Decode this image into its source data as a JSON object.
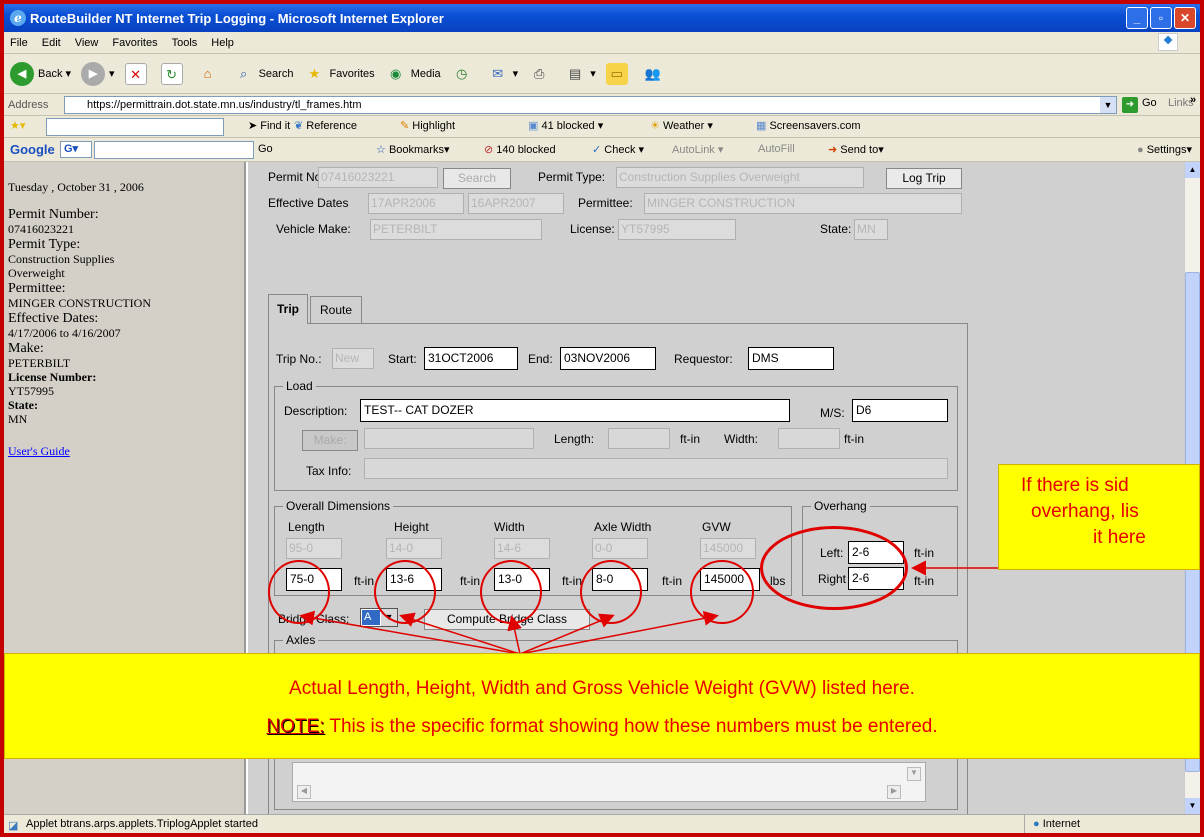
{
  "window": {
    "title": "RouteBuilder NT Internet Trip Logging - Microsoft Internet Explorer"
  },
  "menu": [
    "File",
    "Edit",
    "View",
    "Favorites",
    "Tools",
    "Help"
  ],
  "toolbar": {
    "back": "Back",
    "search": "Search",
    "favorites": "Favorites",
    "media": "Media"
  },
  "address": {
    "label": "Address",
    "url": "https://permittrain.dot.state.mn.us/industry/tl_frames.htm",
    "go": "Go",
    "links": "Links"
  },
  "linksbar": {
    "findit": "Find it",
    "reference": "Reference",
    "highlight": "Highlight",
    "blocked": "41 blocked",
    "weather": "Weather",
    "screensavers": "Screensavers.com"
  },
  "google": {
    "label": "Google",
    "go": "Go",
    "bookmarks": "Bookmarks",
    "blocked": "140 blocked",
    "check": "Check",
    "autolink": "AutoLink",
    "autofill": "AutoFill",
    "sendto": "Send to",
    "settings": "Settings"
  },
  "left": {
    "date": "Tuesday , October 31 , 2006",
    "permit_number_label": "Permit Number:",
    "permit_number": "07416023221",
    "permit_type_label": "Permit Type:",
    "permit_type": "Construction Supplies Overweight",
    "permittee_label": "Permittee:",
    "permittee": "MINGER CONSTRUCTION",
    "effective_label": "Effective Dates:",
    "effective": "4/17/2006 to 4/16/2007",
    "make_label": "Make:",
    "make": "PETERBILT",
    "license_label": "License Number:",
    "license": "YT57995",
    "state_label": "State:",
    "state": "MN",
    "guide": "User's Guide"
  },
  "form": {
    "permit_no_label": "Permit No.:",
    "permit_no": "07416023221",
    "search_btn": "Search",
    "permit_type_label": "Permit Type:",
    "permit_type": "Construction Supplies Overweight",
    "log_trip": "Log Trip",
    "eff_label": "Effective Dates",
    "eff_start": "17APR2006",
    "eff_end": "16APR2007",
    "permittee_label": "Permittee:",
    "permittee": "MINGER CONSTRUCTION",
    "vmake_label": "Vehicle Make:",
    "vmake": "PETERBILT",
    "license_label": "License:",
    "license": "YT57995",
    "state_label": "State:",
    "state": "MN",
    "tab_trip": "Trip",
    "tab_route": "Route",
    "tripno_label": "Trip No.:",
    "tripno": "New",
    "start_label": "Start:",
    "start": "31OCT2006",
    "end_label": "End:",
    "end": "03NOV2006",
    "requestor_label": "Requestor:",
    "requestor": "DMS",
    "load_label": "Load",
    "desc_label": "Description:",
    "desc": "TEST-- CAT DOZER",
    "ms_label": "M/S:",
    "ms": "D6",
    "make_btn": "Make:",
    "length_label": "Length:",
    "ftin": "ft-in",
    "width_label": "Width:",
    "tax_label": "Tax Info:",
    "overall_label": "Overall Dimensions",
    "col_length": "Length",
    "col_height": "Height",
    "col_width": "Width",
    "col_axle": "Axle Width",
    "col_gvw": "GVW",
    "max_length": "95-0",
    "max_height": "14-0",
    "max_width": "14-6",
    "max_axle": "0-0",
    "max_gvw": "145000",
    "length": "75-0",
    "height": "13-6",
    "width": "13-0",
    "axle": "8-0",
    "gvw": "145000",
    "lbs": "lbs",
    "overhang_label": "Overhang",
    "left_label": "Left:",
    "left": "2-6",
    "right_label": "Right",
    "right": "2-6",
    "bridge_label": "Bridge Class:",
    "bridge": "A",
    "compute": "Compute Bridge Class",
    "axles_label": "Axles"
  },
  "callouts": {
    "side1": "If there is sid",
    "side2": "overhang, lis",
    "side3": "it here",
    "bottom1": "Actual Length, Height, Width and Gross Vehicle Weight (GVW) listed here.",
    "note_label": "NOTE:",
    "bottom2": " This is the specific format showing how these numbers must be entered."
  },
  "status": {
    "text": "Applet btrans.arps.applets.TriplogApplet started",
    "zone": "Internet"
  },
  "colors": {
    "callout_bg": "#ffff00",
    "callout_text": "#e60000",
    "ring": "#e00000",
    "xp_title": "#0a4fd4"
  }
}
